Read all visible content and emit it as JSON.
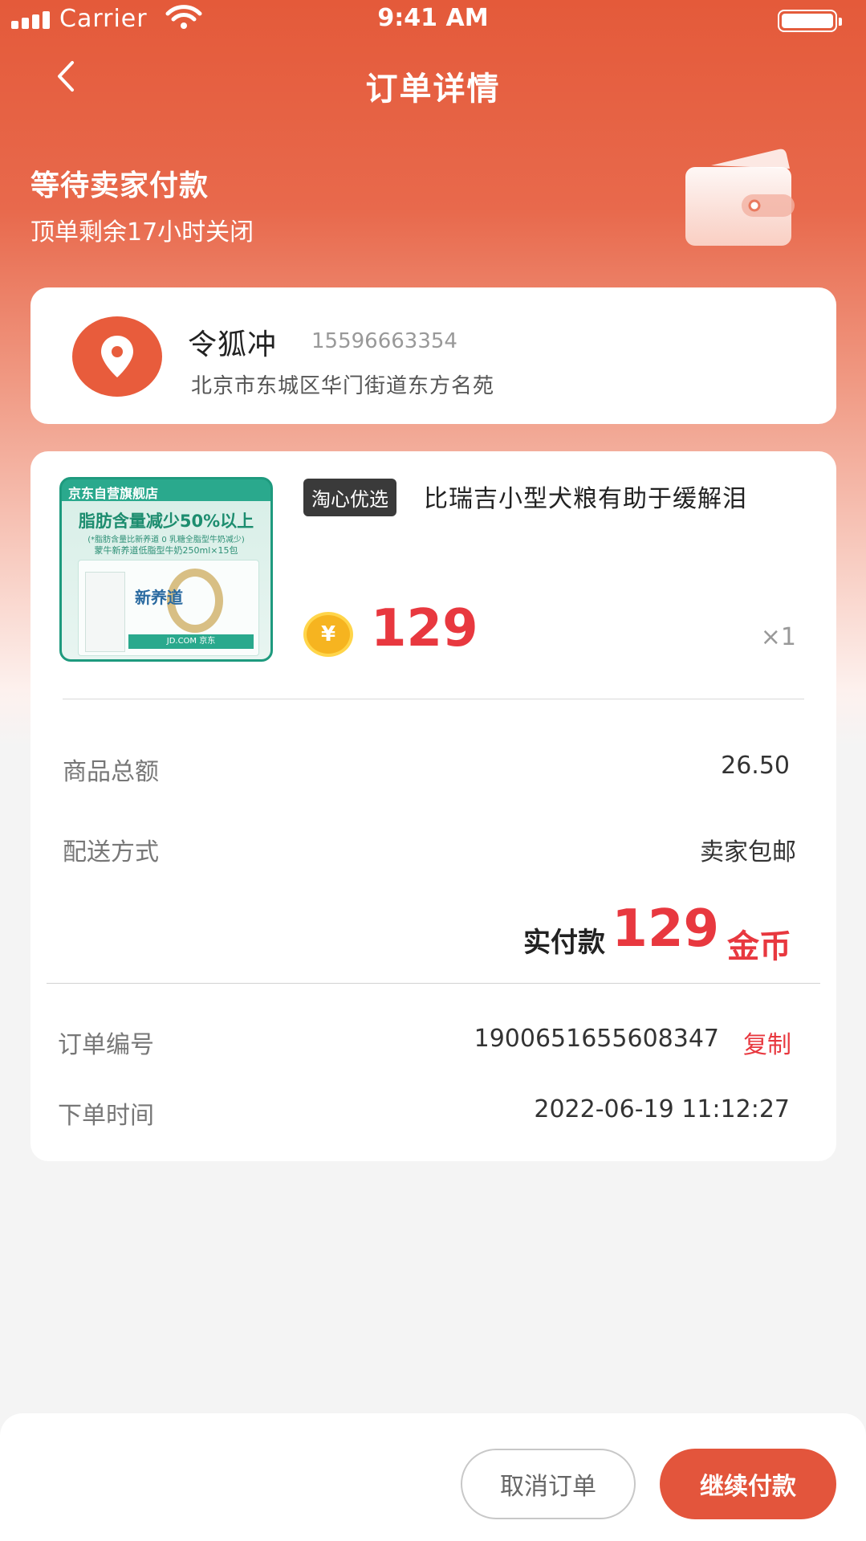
{
  "status_bar": {
    "carrier": "Carrier",
    "time": "9:41 AM"
  },
  "nav": {
    "title": "订单详情",
    "back_icon": "chevron-left-icon"
  },
  "order_status": {
    "title": "等待卖家付款",
    "countdown": "顶单剩余17小时关闭",
    "icon": "wallet-icon"
  },
  "address": {
    "name": "令狐冲",
    "phone": "15596663354",
    "address": "北京市东城区华门街道东方名苑",
    "icon": "location-pin-icon"
  },
  "product": {
    "image_texts": {
      "store": "京东自营旗舰店",
      "headline": "脂肪含量减少50%以上",
      "note": "(*脂肪含量比新养道 0 乳糖全脂型牛奶减少)",
      "spec": "蒙牛新养道低脂型牛奶250ml×15包",
      "brand": "新养道",
      "watermark": "JD.COM 京东"
    },
    "tag": "淘心优选",
    "title": "比瑞吉小型犬粮有助于缓解泪",
    "price": "129",
    "quantity": "×1",
    "coin_symbol": "¥"
  },
  "summary": {
    "items": [
      {
        "label": "商品总额",
        "value": "26.50"
      },
      {
        "label": "配送方式",
        "value": "卖家包邮"
      }
    ],
    "paid_label": "实付款",
    "paid_amount": "129",
    "paid_unit": "金币"
  },
  "order_info": {
    "number_label": "订单编号",
    "number": "1900651655608347",
    "copy_label": "复制",
    "time_label": "下单时间",
    "time": "2022-06-19 11:12:27"
  },
  "actions": {
    "cancel": "取消订单",
    "pay": "继续付款"
  },
  "colors": {
    "brand": "#e3553c",
    "price": "#e8383f"
  }
}
